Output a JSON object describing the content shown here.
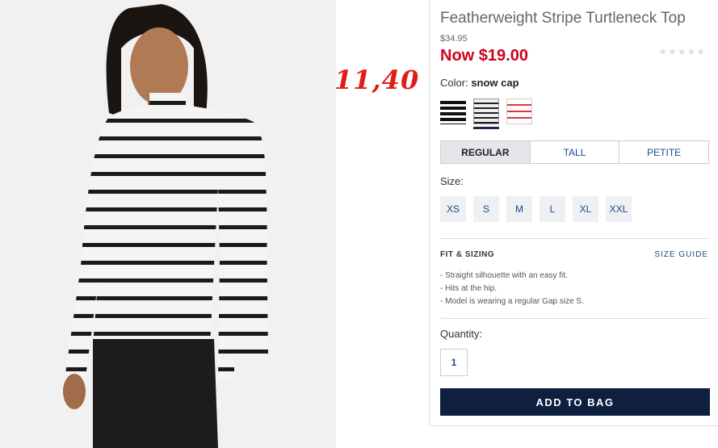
{
  "product": {
    "title": "Featherweight Stripe Turtleneck Top",
    "original_price": "$34.95",
    "now_price": "Now $19.00",
    "stars": "★★★★★"
  },
  "annotation": "11,40",
  "color": {
    "label": "Color:",
    "value": "snow cap"
  },
  "fit_tabs": [
    "REGULAR",
    "TALL",
    "PETITE"
  ],
  "size": {
    "label": "Size:",
    "options": [
      "XS",
      "S",
      "M",
      "L",
      "XL",
      "XXL"
    ]
  },
  "fit_sizing": {
    "heading": "FIT & SIZING",
    "guide_link": "SIZE GUIDE",
    "bullets": [
      "- Straight silhouette with an easy fit.",
      "- Hits at the hip.",
      "- Model is wearing a regular Gap size S."
    ]
  },
  "quantity": {
    "label": "Quantity:",
    "value": "1"
  },
  "add_to_bag": "ADD TO BAG",
  "colors": {
    "accent_red": "#d0021b",
    "annotation_red": "#e21b1b",
    "button_navy": "#0f1f40",
    "link_blue": "#1a4a8a"
  }
}
